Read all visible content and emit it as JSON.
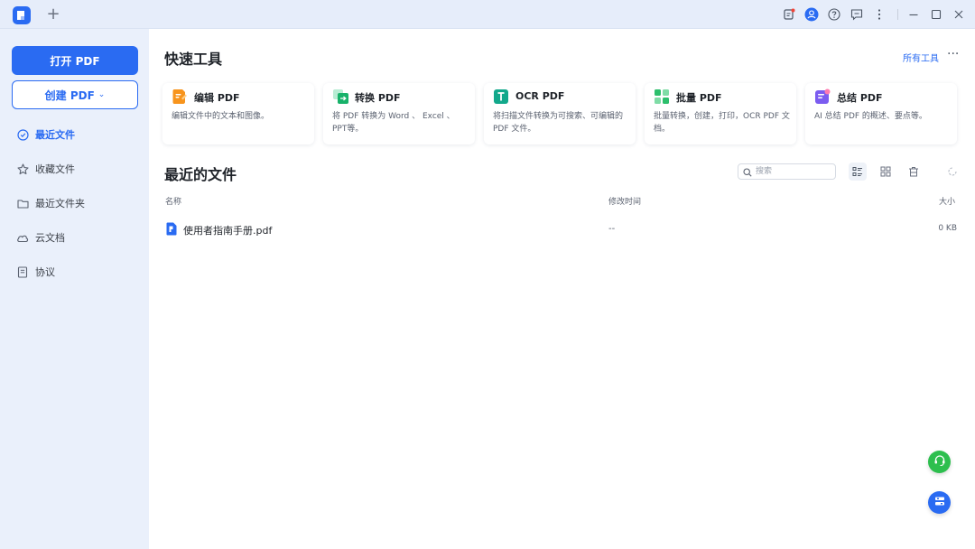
{
  "titlebar": {
    "new_tab_symbol": "+",
    "icons": [
      "notification-icon",
      "user-avatar-icon",
      "help-icon",
      "feedback-icon",
      "more-vertical-icon"
    ],
    "window_controls": [
      "minimize-icon",
      "maximize-icon",
      "close-icon"
    ]
  },
  "sidebar": {
    "open_button": "打开 PDF",
    "create_button": "创建 PDF",
    "items": [
      {
        "label": "最近文件",
        "icon": "clock-icon",
        "active": true
      },
      {
        "label": "收藏文件",
        "icon": "star-icon",
        "active": false
      },
      {
        "label": "最近文件夹",
        "icon": "folder-icon",
        "active": false
      },
      {
        "label": "云文档",
        "icon": "cloud-icon",
        "active": false
      },
      {
        "label": "协议",
        "icon": "document-icon",
        "active": false
      }
    ]
  },
  "quick_tools": {
    "title": "快速工具",
    "all_tools_link": "所有工具",
    "more": "···",
    "tools": [
      {
        "name": "编辑 PDF",
        "desc": "编辑文件中的文本和图像。",
        "icon": "edit-pdf-icon",
        "color": "#f7941d"
      },
      {
        "name": "转换 PDF",
        "desc": "将 PDF 转换为 Word 、 Excel 、 PPT等。",
        "icon": "convert-pdf-icon",
        "color": "#17b26a"
      },
      {
        "name": "OCR PDF",
        "desc": "将扫描文件转换为可搜索、可编辑的 PDF 文件。",
        "icon": "ocr-pdf-icon",
        "color": "#12a88b"
      },
      {
        "name": "批量 PDF",
        "desc": "批量转换，创建，打印，OCR PDF 文档。",
        "icon": "batch-pdf-icon",
        "color": "#2dbf6c"
      },
      {
        "name": "总结 PDF",
        "desc": "AI 总结 PDF 的概述、要点等。",
        "icon": "summarize-pdf-icon",
        "color": "#7b5cf0"
      }
    ]
  },
  "recent": {
    "title": "最近的文件",
    "search_placeholder": "搜索",
    "columns": {
      "name": "名称",
      "modified": "修改时间",
      "size": "大小"
    },
    "files": [
      {
        "name": "使用者指南手册.pdf",
        "modified": "--",
        "size": "0 KB"
      }
    ]
  },
  "colors": {
    "accent": "#2a6bf2",
    "sidebar_bg": "#eaf0fb",
    "support_green": "#2dbf4e",
    "float_blue": "#2a6bf2"
  }
}
